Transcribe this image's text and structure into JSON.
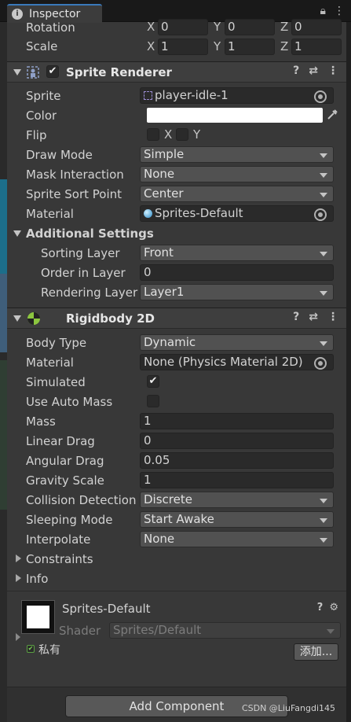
{
  "tabs": {
    "inspector": "Inspector"
  },
  "transform": {
    "rotation_label": "Rotation",
    "scale_label": "Scale",
    "axis_x": "X",
    "axis_y": "Y",
    "axis_z": "Z",
    "rotation": {
      "x": "0",
      "y": "0",
      "z": "0"
    },
    "scale": {
      "x": "1",
      "y": "1",
      "z": "1"
    }
  },
  "sprite_renderer": {
    "title": "Sprite Renderer",
    "sprite_label": "Sprite",
    "sprite_value": "player-idle-1",
    "color_label": "Color",
    "color_value": "#ffffff",
    "flip_label": "Flip",
    "flip_x": "X",
    "flip_y": "Y",
    "draw_mode_label": "Draw Mode",
    "draw_mode_value": "Simple",
    "mask_label": "Mask Interaction",
    "mask_value": "None",
    "sort_point_label": "Sprite Sort Point",
    "sort_point_value": "Center",
    "material_label": "Material",
    "material_value": "Sprites-Default",
    "additional_label": "Additional Settings",
    "sorting_layer_label": "Sorting Layer",
    "sorting_layer_value": "Front",
    "order_label": "Order in Layer",
    "order_value": "0",
    "rendering_label": "Rendering Layer M",
    "rendering_value": "Layer1"
  },
  "rigidbody": {
    "title": "Rigidbody 2D",
    "body_type_label": "Body Type",
    "body_type_value": "Dynamic",
    "material_label": "Material",
    "material_value": "None (Physics Material 2D)",
    "simulated_label": "Simulated",
    "simulated_checked": "✔",
    "auto_mass_label": "Use Auto Mass",
    "mass_label": "Mass",
    "mass_value": "1",
    "linear_drag_label": "Linear Drag",
    "linear_drag_value": "0",
    "angular_drag_label": "Angular Drag",
    "angular_drag_value": "0.05",
    "gravity_label": "Gravity Scale",
    "gravity_value": "1",
    "collision_label": "Collision Detection",
    "collision_value": "Discrete",
    "sleeping_label": "Sleeping Mode",
    "sleeping_value": "Start Awake",
    "interpolate_label": "Interpolate",
    "interpolate_value": "None",
    "constraints_label": "Constraints",
    "info_label": "Info"
  },
  "material_panel": {
    "name": "Sprites-Default",
    "shader_label": "Shader",
    "shader_value": "Sprites/Default",
    "private_label": "私有",
    "add_label": "添加..."
  },
  "footer": {
    "add_component": "Add Component",
    "watermark": "CSDN @LiuFangdi145"
  }
}
